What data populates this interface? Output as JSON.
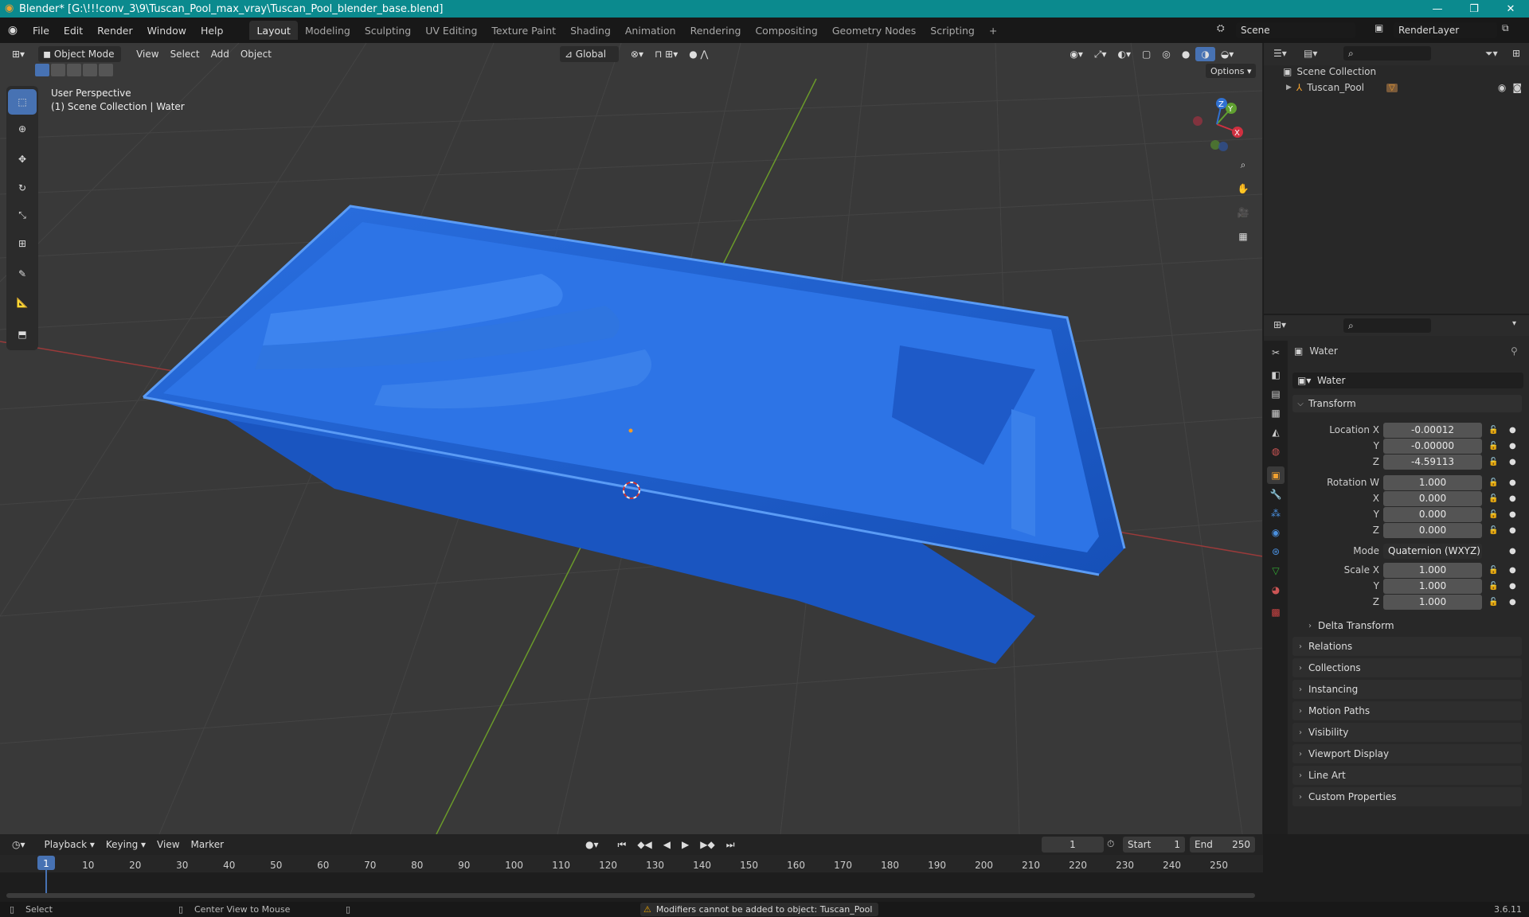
{
  "titlebar": {
    "title": "Blender* [G:\\!!!conv_3\\9\\Tuscan_Pool_max_vray\\Tuscan_Pool_blender_base.blend]",
    "minimize": "—",
    "maximize": "❐",
    "close": "✕"
  },
  "menubar": {
    "menus": [
      "File",
      "Edit",
      "Render",
      "Window",
      "Help"
    ],
    "workspaces": [
      "Layout",
      "Modeling",
      "Sculpting",
      "UV Editing",
      "Texture Paint",
      "Shading",
      "Animation",
      "Rendering",
      "Compositing",
      "Geometry Nodes",
      "Scripting"
    ],
    "add_tab": "+",
    "scene": "Scene",
    "render_layer": "RenderLayer"
  },
  "viewport": {
    "mode": "Object Mode",
    "menus": [
      "View",
      "Select",
      "Add",
      "Object"
    ],
    "transform_orientation": "Global",
    "options": "Options",
    "overlay_line1": "User Perspective",
    "overlay_line2": "(1) Scene Collection | Water",
    "gizmo": {
      "x": "X",
      "y": "Y",
      "z": "Z"
    }
  },
  "outliner": {
    "root": "Scene Collection",
    "items": [
      {
        "name": "Tuscan_Pool"
      }
    ]
  },
  "properties": {
    "object_name": "Water",
    "data_name": "Water",
    "transform_label": "Transform",
    "location": {
      "label": "Location X",
      "x": "-0.00012",
      "y_label": "Y",
      "y": "-0.00000",
      "z_label": "Z",
      "z": "-4.59113"
    },
    "rotation": {
      "label": "Rotation W",
      "w": "1.000",
      "x_label": "X",
      "x": "0.000",
      "y_label": "Y",
      "y": "0.000",
      "z_label": "Z",
      "z": "0.000"
    },
    "mode": {
      "label": "Mode",
      "value": "Quaternion (WXYZ)"
    },
    "scale": {
      "label": "Scale X",
      "x": "1.000",
      "y_label": "Y",
      "y": "1.000",
      "z_label": "Z",
      "z": "1.000"
    },
    "delta_transform": "Delta Transform",
    "panels": [
      "Relations",
      "Collections",
      "Instancing",
      "Motion Paths",
      "Visibility",
      "Viewport Display",
      "Line Art",
      "Custom Properties"
    ]
  },
  "timeline": {
    "menus": [
      "Playback",
      "Keying",
      "View",
      "Marker"
    ],
    "current_frame": "1",
    "start_label": "Start",
    "start": "1",
    "end_label": "End",
    "end": "250",
    "ticks": [
      "1",
      "10",
      "20",
      "30",
      "40",
      "50",
      "60",
      "70",
      "80",
      "90",
      "100",
      "110",
      "120",
      "130",
      "140",
      "150",
      "160",
      "170",
      "180",
      "190",
      "200",
      "210",
      "220",
      "230",
      "240",
      "250"
    ]
  },
  "statusbar": {
    "select": "Select",
    "center_view": "Center View to Mouse",
    "warning": "Modifiers cannot be added to object: Tuscan_Pool",
    "version": "3.6.11"
  },
  "colors": {
    "accent": "#4772b3",
    "titlebar": "#0b8a8e",
    "pool": "#1f5fcc",
    "warning": "#e8a200"
  }
}
